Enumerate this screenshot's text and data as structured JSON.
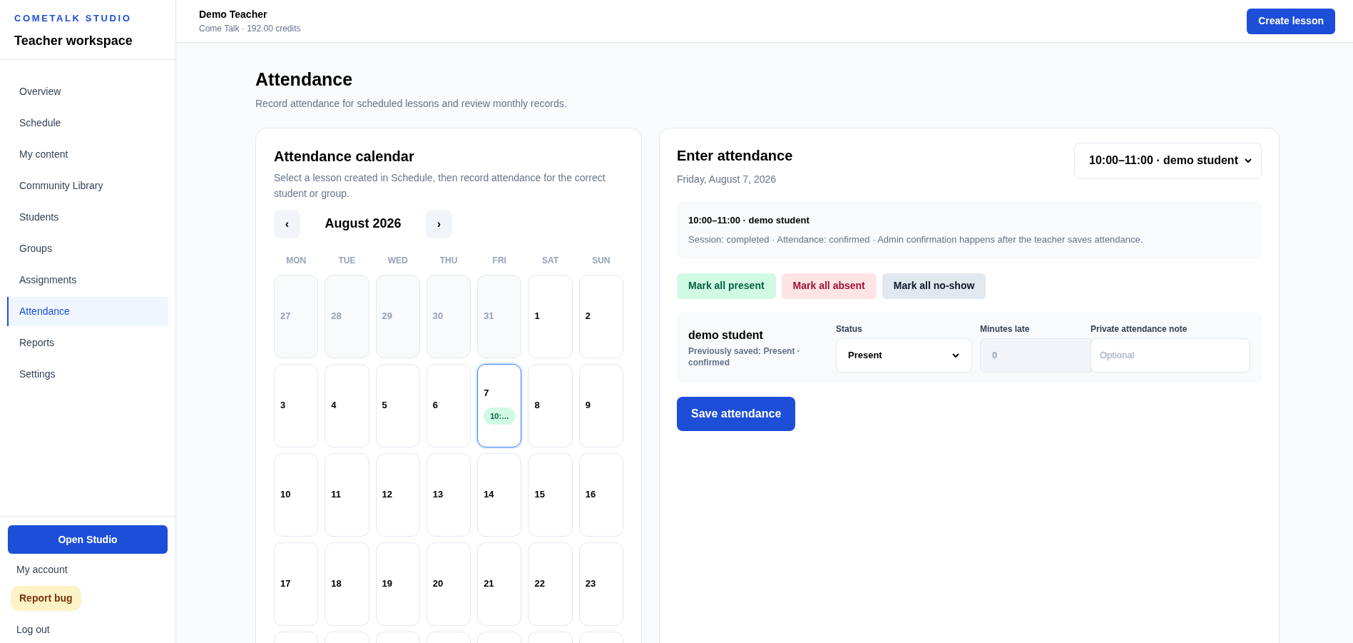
{
  "sidebar": {
    "brand": "COMETALK STUDIO",
    "title": "Teacher workspace",
    "items": [
      {
        "label": "Overview",
        "selected": false
      },
      {
        "label": "Schedule",
        "selected": false
      },
      {
        "label": "My content",
        "selected": false
      },
      {
        "label": "Community Library",
        "selected": false
      },
      {
        "label": "Students",
        "selected": false
      },
      {
        "label": "Groups",
        "selected": false
      },
      {
        "label": "Assignments",
        "selected": false
      },
      {
        "label": "Attendance",
        "selected": true
      },
      {
        "label": "Reports",
        "selected": false
      },
      {
        "label": "Settings",
        "selected": false
      }
    ],
    "open_studio": "Open Studio",
    "my_account": "My account",
    "report_bug": "Report bug",
    "log_out": "Log out"
  },
  "topbar": {
    "user": "Demo Teacher",
    "subtitle": "Come Talk · 192.00 credits",
    "create_button": "Create lesson"
  },
  "page": {
    "title": "Attendance",
    "subtitle": "Record attendance for scheduled lessons and review monthly records."
  },
  "calendar": {
    "title": "Attendance calendar",
    "subtitle": "Select a lesson created in Schedule, then record attendance for the correct student or group.",
    "prev": "‹",
    "month": "August 2026",
    "next": "›",
    "weekdays": [
      "MON",
      "TUE",
      "WED",
      "THU",
      "FRI",
      "SAT",
      "SUN"
    ],
    "weeks": [
      [
        {
          "day": "27",
          "outside": true,
          "selected": false
        },
        {
          "day": "28",
          "outside": true,
          "selected": false
        },
        {
          "day": "29",
          "outside": true,
          "selected": false
        },
        {
          "day": "30",
          "outside": true,
          "selected": false
        },
        {
          "day": "31",
          "outside": true,
          "selected": false
        },
        {
          "day": "1",
          "outside": false,
          "selected": false
        },
        {
          "day": "2",
          "outside": false,
          "selected": false
        }
      ],
      [
        {
          "day": "3",
          "outside": false,
          "selected": false
        },
        {
          "day": "4",
          "outside": false,
          "selected": false
        },
        {
          "day": "5",
          "outside": false,
          "selected": false
        },
        {
          "day": "6",
          "outside": false,
          "selected": false
        },
        {
          "day": "7",
          "outside": false,
          "selected": true,
          "event": "10:…"
        },
        {
          "day": "8",
          "outside": false,
          "selected": false
        },
        {
          "day": "9",
          "outside": false,
          "selected": false
        }
      ],
      [
        {
          "day": "10",
          "outside": false,
          "selected": false
        },
        {
          "day": "11",
          "outside": false,
          "selected": false
        },
        {
          "day": "12",
          "outside": false,
          "selected": false
        },
        {
          "day": "13",
          "outside": false,
          "selected": false
        },
        {
          "day": "14",
          "outside": false,
          "selected": false
        },
        {
          "day": "15",
          "outside": false,
          "selected": false
        },
        {
          "day": "16",
          "outside": false,
          "selected": false
        }
      ],
      [
        {
          "day": "17",
          "outside": false,
          "selected": false
        },
        {
          "day": "18",
          "outside": false,
          "selected": false
        },
        {
          "day": "19",
          "outside": false,
          "selected": false
        },
        {
          "day": "20",
          "outside": false,
          "selected": false
        },
        {
          "day": "21",
          "outside": false,
          "selected": false
        },
        {
          "day": "22",
          "outside": false,
          "selected": false
        },
        {
          "day": "23",
          "outside": false,
          "selected": false
        }
      ]
    ]
  },
  "attendance": {
    "title": "Enter attendance",
    "date": "Friday, August 7, 2026",
    "lesson_select": "10:00–11:00 · demo student",
    "info_title": "10:00–11:00 · demo student",
    "info_text": "Session: completed · Attendance: confirmed · Admin confirmation happens after the teacher saves attendance.",
    "bulk_buttons": [
      {
        "label": "Mark all present",
        "kind": "present"
      },
      {
        "label": "Mark all absent",
        "kind": "absent"
      },
      {
        "label": "Mark all no-show",
        "kind": "noshow"
      }
    ],
    "students": [
      {
        "name": "demo student",
        "previous": "Previously saved: Present · confirmed",
        "status_label": "Status",
        "status": "Present",
        "late_label": "Minutes late",
        "late_placeholder": "0",
        "late_disabled": true,
        "note_label": "Private attendance note",
        "note_placeholder": "Optional"
      }
    ],
    "save_button": "Save attendance"
  }
}
